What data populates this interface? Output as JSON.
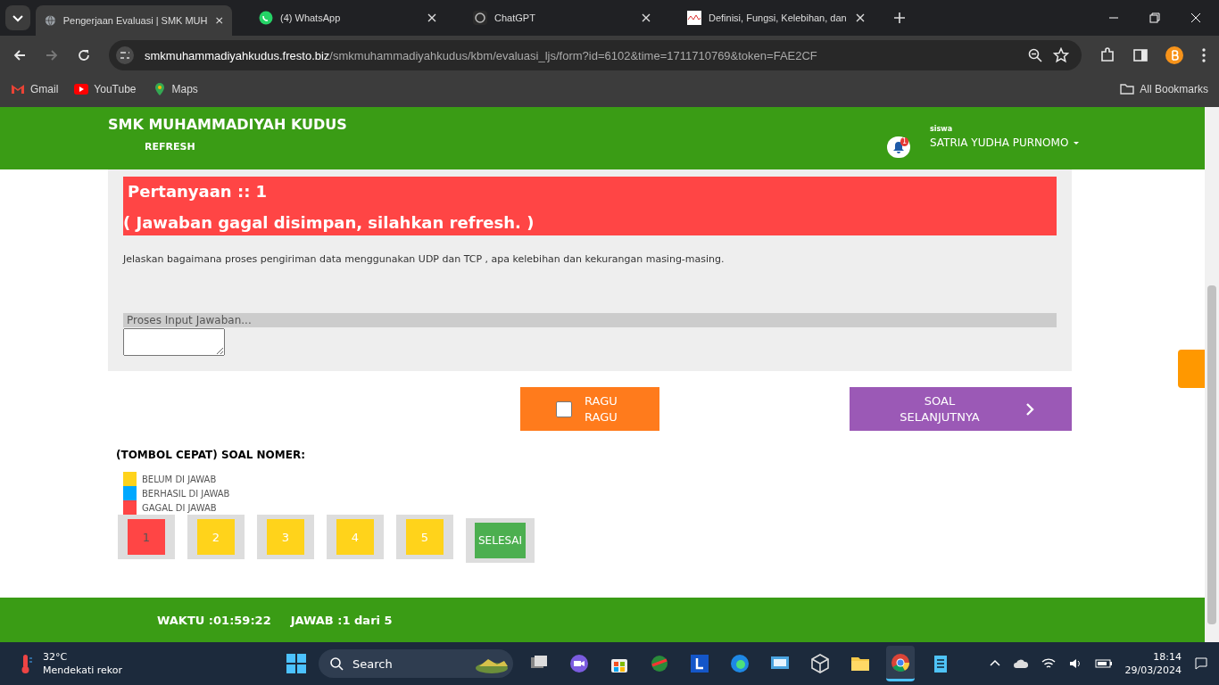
{
  "browser": {
    "tabs": [
      {
        "title": "Pengerjaan Evaluasi | SMK MUH",
        "selected": true
      },
      {
        "title": "(4) WhatsApp",
        "selected": false
      },
      {
        "title": "ChatGPT",
        "selected": false
      },
      {
        "title": "Definisi, Fungsi, Kelebihan, dan",
        "selected": false
      }
    ],
    "url_host": "smkmuhammadiyahkudus.fresto.biz",
    "url_path": "/smkmuhammadiyahkudus/kbm/evaluasi_ljs/form?id=6102&time=1711710769&token=FAE2CF",
    "bookmarks": [
      "Gmail",
      "YouTube",
      "Maps"
    ],
    "all_bookmarks": "All Bookmarks"
  },
  "header": {
    "school": "SMK MUHAMMADIYAH KUDUS",
    "refresh": "REFRESH",
    "notification_count": "1",
    "role": "siswa",
    "user": "SATRIA YUDHA PURNOMO"
  },
  "question": {
    "title": "Pertanyaan :: 1",
    "error": "( Jawaban gagal disimpan, silahkan refresh. )",
    "text": "Jelaskan bagaimana proses pengiriman data menggunakan  UDP dan TCP , apa kelebihan dan kekurangan masing-masing.",
    "input_status": "Proses Input Jawaban..."
  },
  "doubt": {
    "label": "RAGU RAGU",
    "checked": false
  },
  "next": {
    "label": "SOAL SELANJUTNYA"
  },
  "quick": {
    "title": "(TOMBOL CEPAT) SOAL NOMER:",
    "legend": [
      {
        "label": "BELUM DI JAWAB",
        "color": "#ffd31b"
      },
      {
        "label": "BERHASIL DI JAWAB",
        "color": "#00a8ff"
      },
      {
        "label": "GAGAL DI JAWAB",
        "color": "#ff4545"
      }
    ],
    "numbers": [
      {
        "label": "1",
        "color": "#ff4545",
        "selected": true
      },
      {
        "label": "2",
        "color": "#ffd31b",
        "selected": false
      },
      {
        "label": "3",
        "color": "#ffd31b",
        "selected": false
      },
      {
        "label": "4",
        "color": "#ffd31b",
        "selected": false
      },
      {
        "label": "5",
        "color": "#ffd31b",
        "selected": false
      }
    ],
    "finish": "SELESAI"
  },
  "footer": {
    "time": "WAKTU :01:59:22",
    "answered": "JAWAB :1 dari 5"
  },
  "taskbar": {
    "temperature": "32°C",
    "weather": "Mendekati rekor",
    "search": "Search",
    "time": "18:14",
    "date": "29/03/2024"
  }
}
